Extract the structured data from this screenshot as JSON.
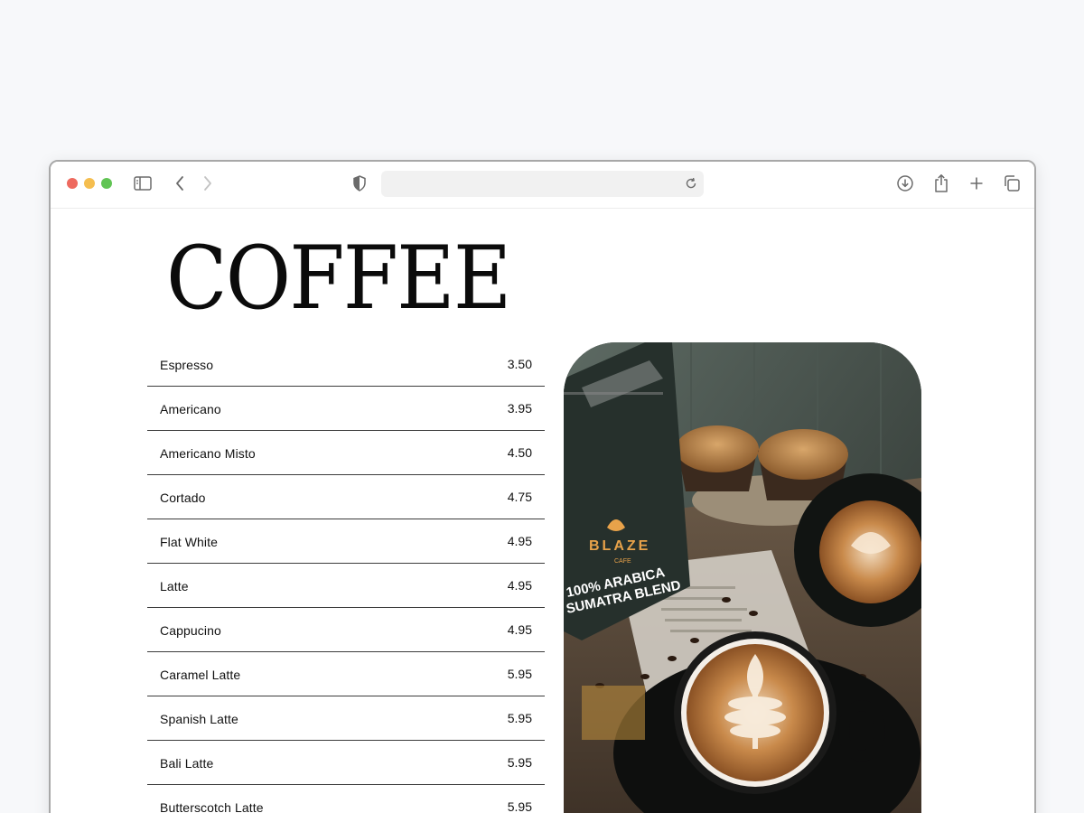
{
  "browser": {
    "address_value": "",
    "icons": [
      "sidebar-icon",
      "back-icon",
      "forward-icon",
      "shield-icon",
      "reload-icon",
      "download-icon",
      "share-icon",
      "plus-icon",
      "tabs-icon"
    ]
  },
  "page": {
    "title": "COFFEE",
    "menu_items": [
      {
        "name": "Espresso",
        "price": "3.50"
      },
      {
        "name": "Americano",
        "price": "3.95"
      },
      {
        "name": "Americano Misto",
        "price": "4.50"
      },
      {
        "name": "Cortado",
        "price": "4.75"
      },
      {
        "name": "Flat White",
        "price": "4.95"
      },
      {
        "name": "Latte",
        "price": "4.95"
      },
      {
        "name": "Cappucino",
        "price": "4.95"
      },
      {
        "name": "Caramel Latte",
        "price": "5.95"
      },
      {
        "name": "Spanish Latte",
        "price": "5.95"
      },
      {
        "name": "Bali Latte",
        "price": "5.95"
      },
      {
        "name": "Butterscotch Latte",
        "price": "5.95"
      }
    ],
    "photo": {
      "bag_brand": "BLAZE",
      "bag_brand_sub": "CAFE",
      "bag_line1": "100% ARABICA",
      "bag_line2": "SUMATRA BLEND"
    }
  },
  "colors": {
    "traffic_red": "#ee6a5f",
    "traffic_yellow": "#f5be4f",
    "traffic_green": "#61c454",
    "divider": "#3c3c3c",
    "bag_accent": "#e8a24a"
  }
}
